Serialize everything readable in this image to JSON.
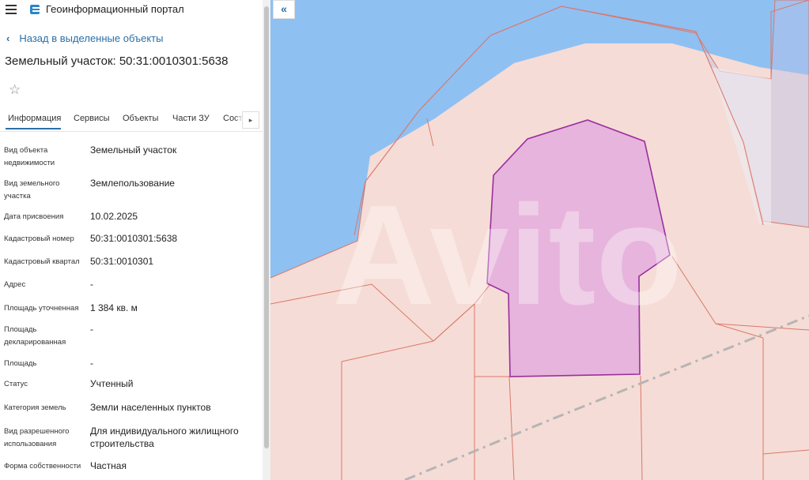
{
  "header": {
    "app_title": "Геоинформационный портал",
    "menu_icon": "hamburger-icon",
    "logo_icon": "portal-logo-icon"
  },
  "nav": {
    "back_label": "Назад в выделенные объекты",
    "back_icon": "chevron-left-icon"
  },
  "page": {
    "title": "Земельный участок: 50:31:0010301:5638",
    "favorite_icon": "star-icon"
  },
  "tabs": [
    {
      "label": "Информация",
      "active": true
    },
    {
      "label": "Сервисы"
    },
    {
      "label": "Объекты"
    },
    {
      "label": "Части ЗУ"
    },
    {
      "label": "Соста"
    }
  ],
  "tab_scroll_icon": "chevron-right-icon",
  "properties": [
    {
      "label": "Вид объекта недвижимости",
      "value": "Земельный участок"
    },
    {
      "label": "Вид земельного участка",
      "value": "Землепользование"
    },
    {
      "label": "Дата присвоения",
      "value": "10.02.2025"
    },
    {
      "label": "Кадастровый номер",
      "value": "50:31:0010301:5638"
    },
    {
      "label": "Кадастровый квартал",
      "value": "50:31:0010301"
    },
    {
      "label": "Адрес",
      "value": "-"
    },
    {
      "label": "Площадь уточненная",
      "value": "1 384 кв. м"
    },
    {
      "label": "Площадь декларированная",
      "value": "-"
    },
    {
      "label": "Площадь",
      "value": "-"
    },
    {
      "label": "Статус",
      "value": "Учтенный"
    },
    {
      "label": "Категория земель",
      "value": "Земли населенных пунктов"
    },
    {
      "label": "Вид разрешенного использования",
      "value": "Для индивидуального жилищного строительства"
    },
    {
      "label": "Форма собственности",
      "value": "Частная"
    }
  ],
  "map": {
    "collapse_icon": "double-chevron-left-icon",
    "watermark": "Avito",
    "colors": {
      "water": "#8fc0f2",
      "parcel_fill": "#f6dcd6",
      "parcel_border": "#d9786a",
      "selected_fill": "#e6b4dc",
      "selected_border": "#9a2ea0",
      "road_dash": "#b5b5b5"
    }
  }
}
